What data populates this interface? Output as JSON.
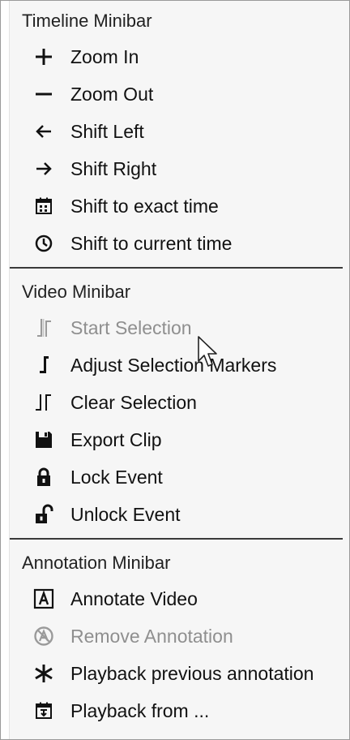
{
  "sections": [
    {
      "header": "Timeline Minibar",
      "items": [
        {
          "label": "Zoom In",
          "icon": "plus-icon",
          "enabled": true
        },
        {
          "label": "Zoom Out",
          "icon": "minus-icon",
          "enabled": true
        },
        {
          "label": "Shift Left",
          "icon": "arrow-left-icon",
          "enabled": true
        },
        {
          "label": "Shift Right",
          "icon": "arrow-right-icon",
          "enabled": true
        },
        {
          "label": "Shift to exact time",
          "icon": "calendar-icon",
          "enabled": true
        },
        {
          "label": "Shift to current time",
          "icon": "clock-icon",
          "enabled": true
        }
      ]
    },
    {
      "header": "Video Minibar",
      "items": [
        {
          "label": "Start Selection",
          "icon": "start-selection-icon",
          "enabled": false
        },
        {
          "label": "Adjust Selection Markers",
          "icon": "adjust-marker-icon",
          "enabled": true
        },
        {
          "label": "Clear Selection",
          "icon": "clear-selection-icon",
          "enabled": true
        },
        {
          "label": "Export Clip",
          "icon": "save-disk-icon",
          "enabled": true
        },
        {
          "label": "Lock Event",
          "icon": "lock-icon",
          "enabled": true
        },
        {
          "label": "Unlock Event",
          "icon": "unlock-icon",
          "enabled": true
        }
      ]
    },
    {
      "header": "Annotation Minibar",
      "items": [
        {
          "label": "Annotate Video",
          "icon": "annotate-a-icon",
          "enabled": true
        },
        {
          "label": "Remove Annotation",
          "icon": "remove-annotation-icon",
          "enabled": false
        },
        {
          "label": "Playback previous annotation",
          "icon": "asterisk-icon",
          "enabled": true
        },
        {
          "label": "Playback from ...",
          "icon": "calendar-playback-icon",
          "enabled": true
        }
      ]
    }
  ],
  "colors": {
    "background": "#f6f6f6",
    "text": "#111111",
    "disabled_text": "#8f8f8f",
    "separator": "#3a3a3a"
  }
}
